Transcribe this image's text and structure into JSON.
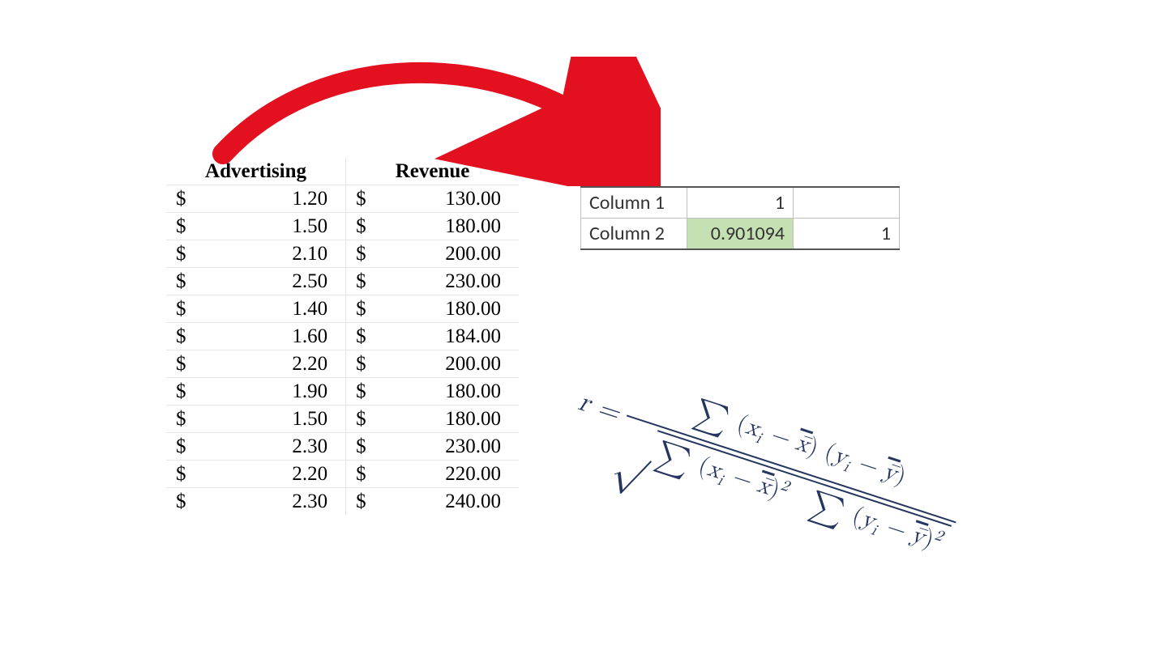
{
  "data_table": {
    "headers": [
      "Advertising",
      "Revenue"
    ],
    "currency": "$",
    "rows": [
      {
        "adv": "1.20",
        "rev": "130.00"
      },
      {
        "adv": "1.50",
        "rev": "180.00"
      },
      {
        "adv": "2.10",
        "rev": "200.00"
      },
      {
        "adv": "2.50",
        "rev": "230.00"
      },
      {
        "adv": "1.40",
        "rev": "180.00"
      },
      {
        "adv": "1.60",
        "rev": "184.00"
      },
      {
        "adv": "2.20",
        "rev": "200.00"
      },
      {
        "adv": "1.90",
        "rev": "180.00"
      },
      {
        "adv": "1.50",
        "rev": "180.00"
      },
      {
        "adv": "2.30",
        "rev": "230.00"
      },
      {
        "adv": "2.20",
        "rev": "220.00"
      },
      {
        "adv": "2.30",
        "rev": "240.00"
      }
    ]
  },
  "corr_matrix": {
    "rows": [
      {
        "label": "Column 1",
        "c1": "1",
        "c2": ""
      },
      {
        "label": "Column 2",
        "c1": "0.901094",
        "c2": "1"
      }
    ],
    "highlight_value": "0.901094"
  },
  "formula": {
    "left": "r =",
    "numerator_parts": {
      "sum": "∑",
      "term1_open": "(",
      "term1_var": "x",
      "term1_sub": "i",
      "term1_minus": " − ",
      "term1_bar": "x̄",
      "term1_close": ")",
      "term2_open": "(",
      "term2_var": "y",
      "term2_sub": "i",
      "term2_minus": " − ",
      "term2_bar": "ȳ",
      "term2_close": ")"
    },
    "denominator_parts": {
      "sqrt": "√",
      "sum1": "∑",
      "t1_open": "(",
      "t1_var": "x",
      "t1_sub": "i",
      "t1_minus": " − ",
      "t1_bar": "x̄",
      "t1_close": ")",
      "t1_pow": "2",
      "sum2": "∑",
      "t2_open": "(",
      "t2_var": "y",
      "t2_sub": "i",
      "t2_minus": " − ",
      "t2_bar": "ȳ",
      "t2_close": ")",
      "t2_pow": "2"
    }
  },
  "arrow": {
    "color": "#e31020"
  }
}
